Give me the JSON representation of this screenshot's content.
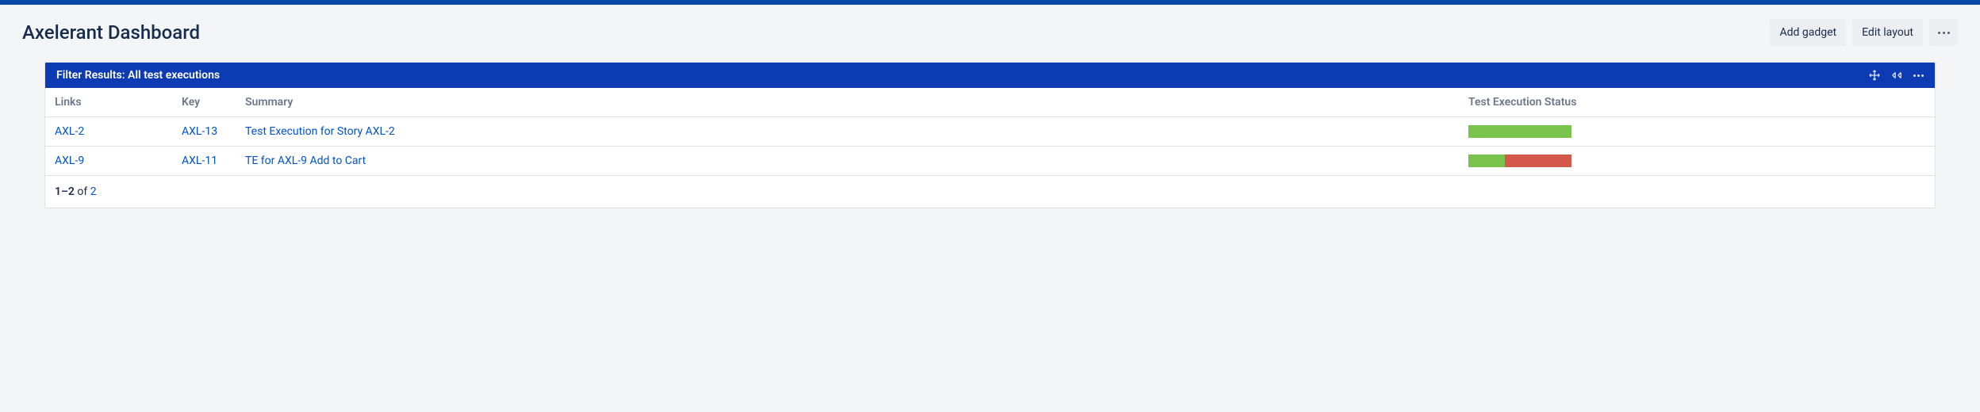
{
  "header": {
    "title": "Axelerant Dashboard",
    "add_gadget": "Add gadget",
    "edit_layout": "Edit layout"
  },
  "gadget": {
    "title": "Filter Results: All test executions",
    "columns": {
      "links": "Links",
      "key": "Key",
      "summary": "Summary",
      "status": "Test Execution Status"
    },
    "rows": [
      {
        "links": "AXL-2",
        "key": "AXL-13",
        "summary": "Test Execution for Story AXL-2",
        "status_segments": [
          {
            "color": "green",
            "pct": 100
          }
        ]
      },
      {
        "links": "AXL-9",
        "key": "AXL-11",
        "summary": "TE for AXL-9 Add to Cart",
        "status_segments": [
          {
            "color": "green",
            "pct": 35
          },
          {
            "color": "red",
            "pct": 65
          }
        ]
      }
    ],
    "footer": {
      "range_start": "1",
      "range_end": "2",
      "of_word": "of",
      "total": "2"
    }
  },
  "colors": {
    "green": "#79c24b",
    "red": "#d4574c",
    "link": "#0052cc"
  }
}
